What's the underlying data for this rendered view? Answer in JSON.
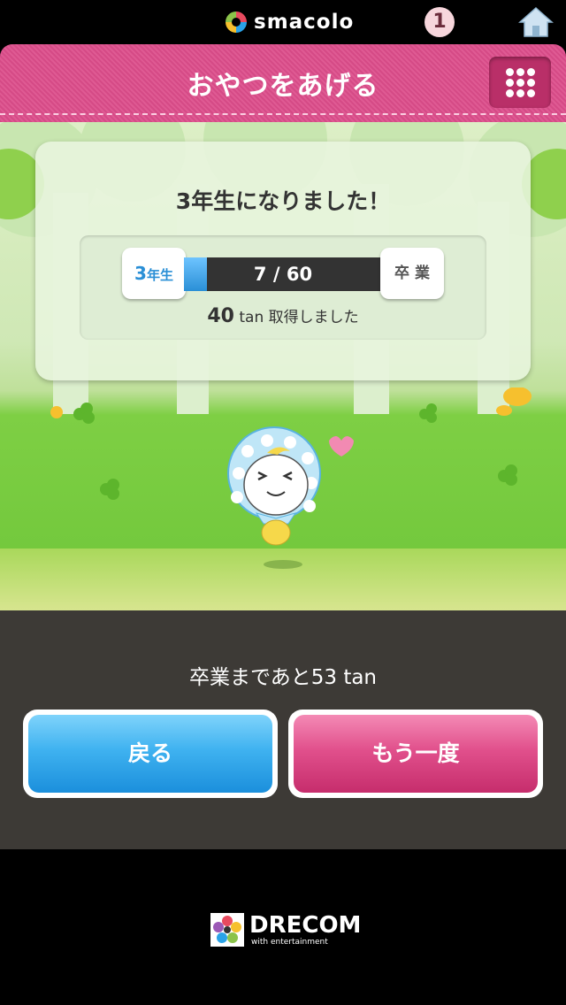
{
  "topbar": {
    "app_name": "smacolo",
    "notification_count": "1"
  },
  "header": {
    "title": "おやつをあげる"
  },
  "panel": {
    "title": "3年生になりました！",
    "current_grade_num": "3",
    "current_grade_suffix": "年生",
    "progress_text": "7 / 60",
    "progress_fraction": 0.117,
    "next_grade_label": "卒 業",
    "earned_amount": "40",
    "earned_text": " tan 取得しました"
  },
  "bottom": {
    "remaining_text": "卒業まであと53 tan",
    "back_button": "戻る",
    "again_button": "もう一度"
  },
  "footer": {
    "brand": "DRECOM",
    "tagline": "with entertainment"
  },
  "colors": {
    "header_pink": "#d54a86",
    "progress_blue": "#2a8fd6",
    "bottom_bg": "#3d3a36"
  }
}
